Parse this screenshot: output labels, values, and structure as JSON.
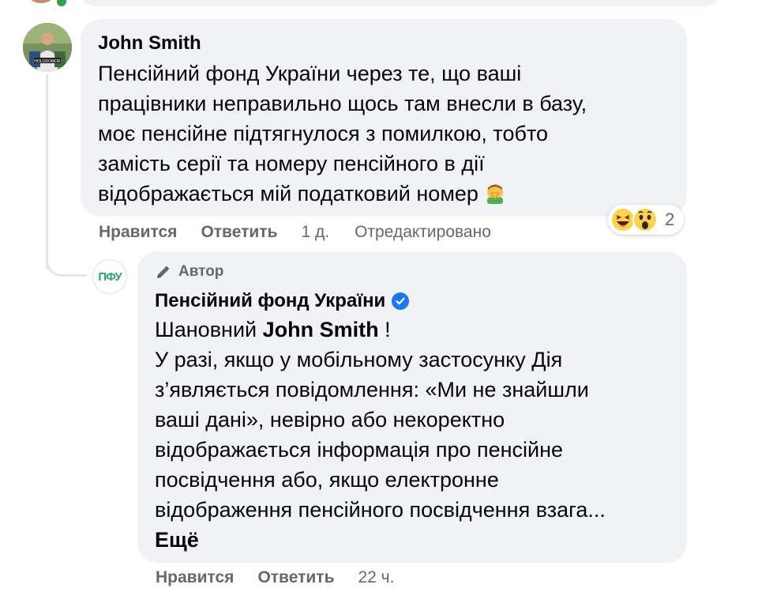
{
  "comment": {
    "author": "John Smith",
    "lines": [
      "Пенсійний фонд України через те, що ваші",
      "працівники неправильно щось там внесли в базу,",
      "моє пенсійне підтягнулося з помилкою, тобто",
      "замість серії та номеру пенсійного в дії",
      "відображається мій податковий номер"
    ],
    "like_label": "Нравится",
    "reply_label": "Ответить",
    "time": "1 д.",
    "edited_label": "Отредактировано",
    "reaction_count": "2",
    "reaction_icons": [
      "laughing-face-icon",
      "surprised-face-icon"
    ]
  },
  "reply": {
    "badge_label": "Автор",
    "page_name": "Пенсійний фонд України",
    "avatar_text": "ПФУ",
    "greeting_prefix": "Шановний ",
    "greeting_name": "John Smith",
    "greeting_suffix": " !",
    "lines": [
      "У разі, якщо у мобільному застосунку Дія",
      "з’являється повідомлення: «Ми не знайшли",
      "ваші дані», невірно або некоректно",
      "відображається інформація про пенсійне",
      "посвідчення або, якщо електронне",
      "відображення пенсійного посвідчення взага..."
    ],
    "more_label": "Ещё",
    "like_label": "Нравится",
    "reply_label": "Ответить",
    "time": "22 ч."
  },
  "colors": {
    "bubble": "#f0f2f5",
    "meta_text": "#65676b",
    "verified": "#1877f2",
    "pfu_green": "#2aa56e"
  }
}
